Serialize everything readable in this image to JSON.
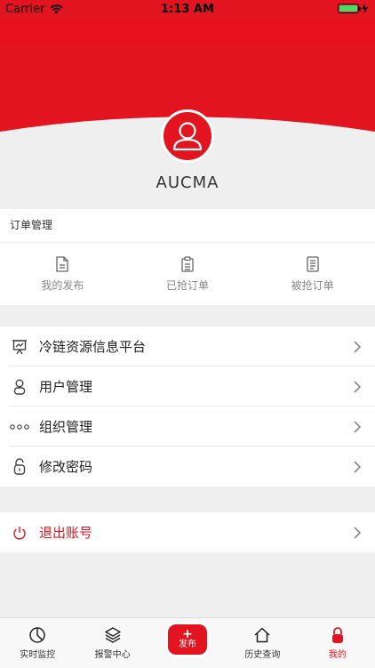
{
  "status_bar": {
    "carrier": "Carrier",
    "time": "1:13 AM"
  },
  "profile": {
    "username": "AUCMA"
  },
  "orders": {
    "title": "订单管理",
    "items": [
      {
        "label": "我的发布",
        "icon": "document-icon"
      },
      {
        "label": "已抢订单",
        "icon": "clipboard-icon"
      },
      {
        "label": "被抢订单",
        "icon": "list-document-icon"
      }
    ]
  },
  "menu": {
    "items": [
      {
        "label": "冷链资源信息平台",
        "icon": "presentation-icon"
      },
      {
        "label": "用户管理",
        "icon": "user-icon"
      },
      {
        "label": "组织管理",
        "icon": "more-dots-icon"
      },
      {
        "label": "修改密码",
        "icon": "unlock-icon"
      }
    ],
    "logout": {
      "label": "退出账号",
      "icon": "power-icon"
    }
  },
  "tabbar": {
    "tabs": [
      {
        "label": "实时监控"
      },
      {
        "label": "报警中心"
      },
      {
        "label": "发布",
        "center_plus": "+"
      },
      {
        "label": "历史查询"
      },
      {
        "label": "我的"
      }
    ],
    "active_index": 4
  },
  "colors": {
    "brand_red": "#e2141f",
    "background": "#efefef",
    "battery_green": "#4cd964"
  }
}
